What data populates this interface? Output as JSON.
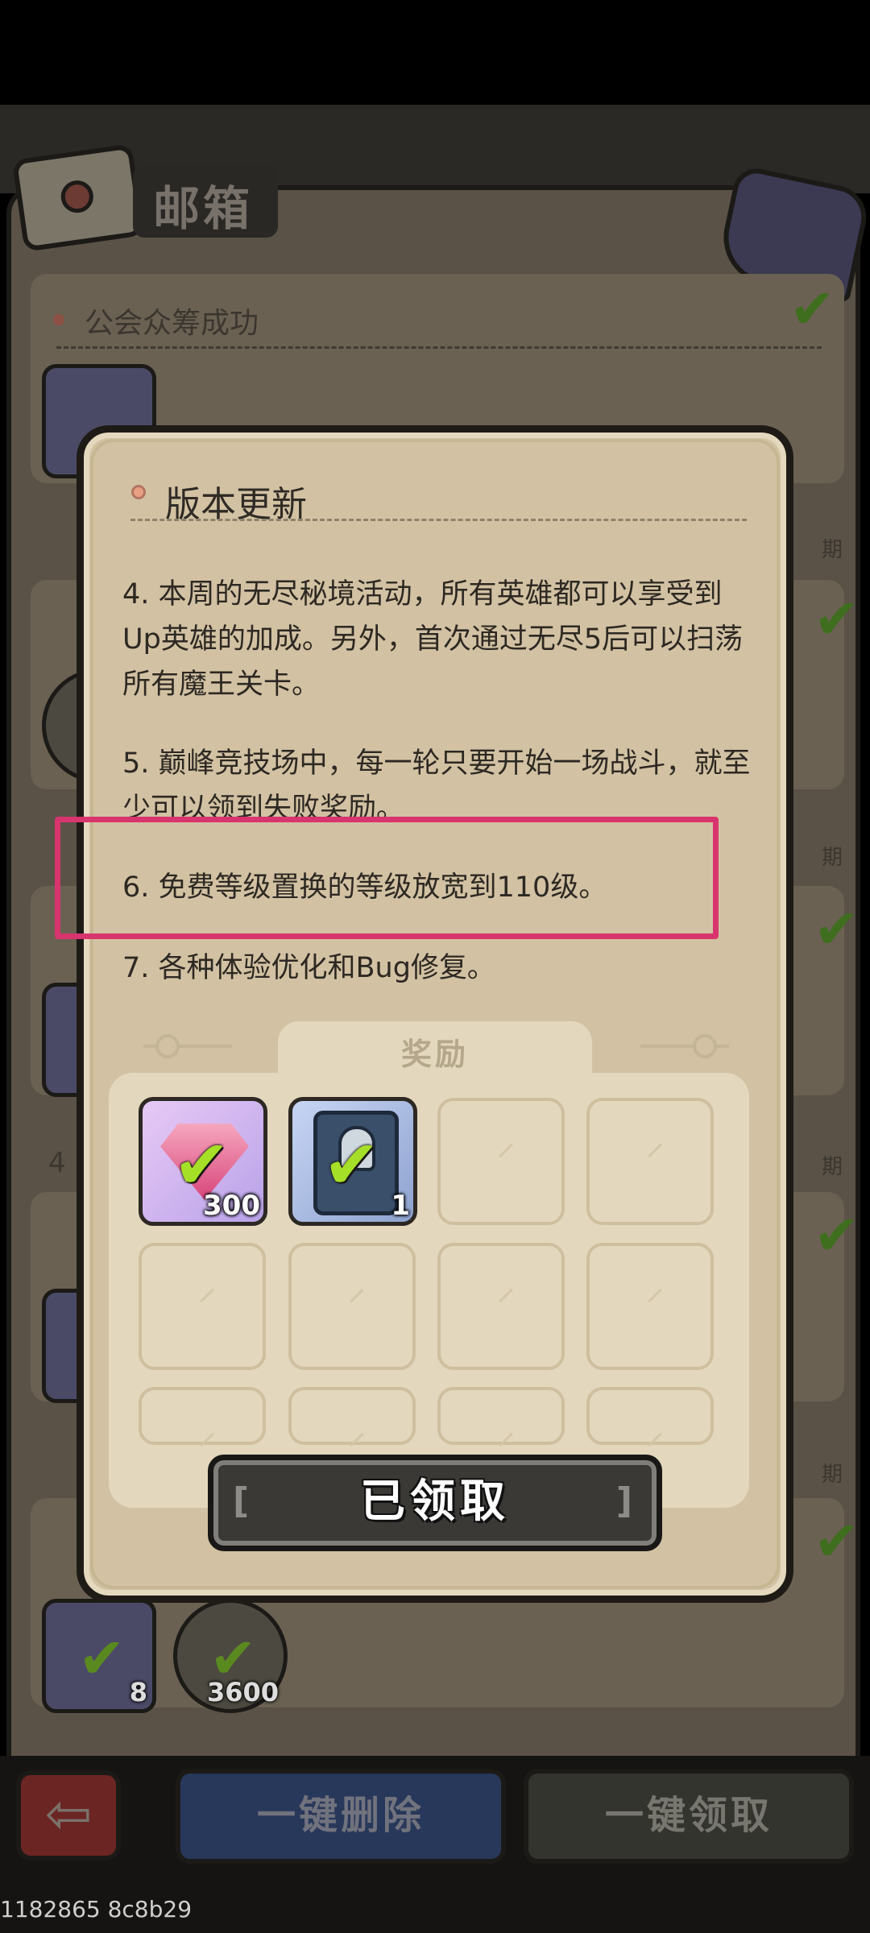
{
  "mailbox": {
    "title": "邮箱",
    "first_mail_title": "公会众筹成功",
    "side_label_partial": "期",
    "row_label_partial": "4",
    "background_items": [
      {
        "icon": "gem-icon",
        "count": "8"
      },
      {
        "icon": "coin-icon",
        "count": "3600"
      }
    ],
    "buttons": {
      "back_symbol": "⇦",
      "delete_all": "一键删除",
      "claim_all": "一键领取"
    }
  },
  "modal": {
    "title": "版本更新",
    "paragraphs": {
      "p4": "4. 本周的无尽秘境活动，所有英雄都可以享受到Up英雄的加成。另外，首次通过无尽5后可以扫荡所有魔王关卡。",
      "p5": "5. 巅峰竞技场中，每一轮只要开始一场战斗，就至少可以领到失败奖励。",
      "p6": "6. 免费等级置换的等级放宽到110级。",
      "p7": "7. 各种体验优化和Bug修复。"
    },
    "reward_title": "奖励",
    "rewards": [
      {
        "icon": "gem-icon",
        "count": "300",
        "claimed": true
      },
      {
        "icon": "hero-book-icon",
        "count": "1",
        "claimed": true
      }
    ],
    "claimed_button": "已领取"
  },
  "footer_id": "1182865 8c8b29",
  "colors": {
    "highlight": "#d8346e",
    "modal_bg": "#d2c2a3",
    "check_green": "#a6df27"
  }
}
